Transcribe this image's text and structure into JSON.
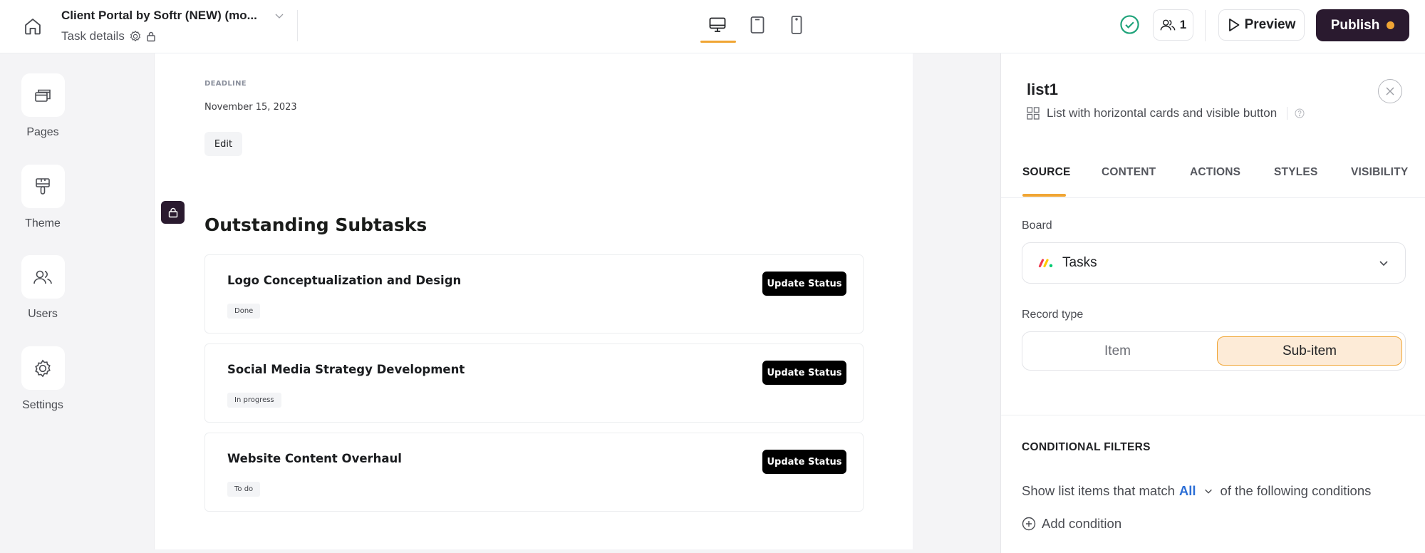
{
  "topbar": {
    "app_title": "Client Portal by Softr (NEW) (mo...",
    "page_name": "Task details",
    "devices": [
      {
        "name": "desktop",
        "active": true
      },
      {
        "name": "tablet",
        "active": false
      },
      {
        "name": "mobile",
        "active": false
      }
    ],
    "collaborators_count": "1",
    "preview_label": "Preview",
    "publish_label": "Publish",
    "colors": {
      "accent": "#f0a534",
      "publish_bg": "#2a1a2f",
      "status_ok": "#1fa37a"
    }
  },
  "sidebar": {
    "items": [
      {
        "label": "Pages",
        "icon": "pages-icon"
      },
      {
        "label": "Theme",
        "icon": "paint-roller-icon"
      },
      {
        "label": "Users",
        "icon": "users-icon"
      },
      {
        "label": "Settings",
        "icon": "gear-icon"
      }
    ]
  },
  "canvas": {
    "deadline_label": "DEADLINE",
    "deadline_value": "November 15, 2023",
    "edit_label": "Edit",
    "section_title": "Outstanding Subtasks",
    "subtasks": [
      {
        "title": "Logo Conceptualization and Design",
        "status": "Done",
        "button": "Update Status"
      },
      {
        "title": "Social Media Strategy Development",
        "status": "In progress",
        "button": "Update Status"
      },
      {
        "title": "Website Content Overhaul",
        "status": "To do",
        "button": "Update Status"
      }
    ]
  },
  "panel": {
    "block_name": "list1",
    "block_type": "List with horizontal cards and visible button",
    "tabs": [
      "SOURCE",
      "CONTENT",
      "ACTIONS",
      "STYLES",
      "VISIBILITY"
    ],
    "active_tab": "SOURCE",
    "board_label": "Board",
    "board_value": "Tasks",
    "record_type_label": "Record type",
    "record_type_options": [
      "Item",
      "Sub-item"
    ],
    "record_type_selected": "Sub-item",
    "conditional_filters_title": "CONDITIONAL FILTERS",
    "filter_prefix": "Show list items that match",
    "filter_match": "All",
    "filter_suffix": "of the following conditions",
    "add_condition_label": "Add condition"
  }
}
